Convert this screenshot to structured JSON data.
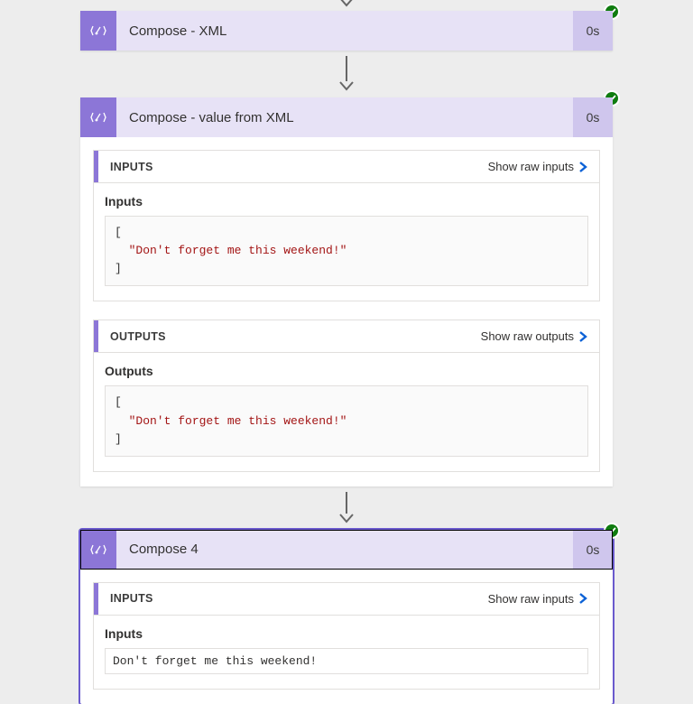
{
  "colors": {
    "accent": "#8c76d7",
    "success": "#107c10",
    "link": "#0b61d6"
  },
  "arrow_hint": "down",
  "steps": [
    {
      "icon": "compose",
      "title": "Compose - XML",
      "duration": "0s",
      "status": "success",
      "selected": false,
      "expanded": false
    },
    {
      "icon": "compose",
      "title": "Compose - value from XML",
      "duration": "0s",
      "status": "success",
      "selected": false,
      "expanded": true,
      "panels": {
        "inputs": {
          "header": "INPUTS",
          "action": "Show raw inputs",
          "subhead": "Inputs",
          "code_lines": [
            "[",
            "  \"Don't forget me this weekend!\"",
            "]"
          ]
        },
        "outputs": {
          "header": "OUTPUTS",
          "action": "Show raw outputs",
          "subhead": "Outputs",
          "code_lines": [
            "[",
            "  \"Don't forget me this weekend!\"",
            "]"
          ]
        }
      }
    },
    {
      "icon": "compose",
      "title": "Compose 4",
      "duration": "0s",
      "status": "success",
      "selected": true,
      "expanded": true,
      "panels": {
        "inputs": {
          "header": "INPUTS",
          "action": "Show raw inputs",
          "subhead": "Inputs",
          "plain": "Don't forget me this weekend!"
        }
      }
    }
  ]
}
